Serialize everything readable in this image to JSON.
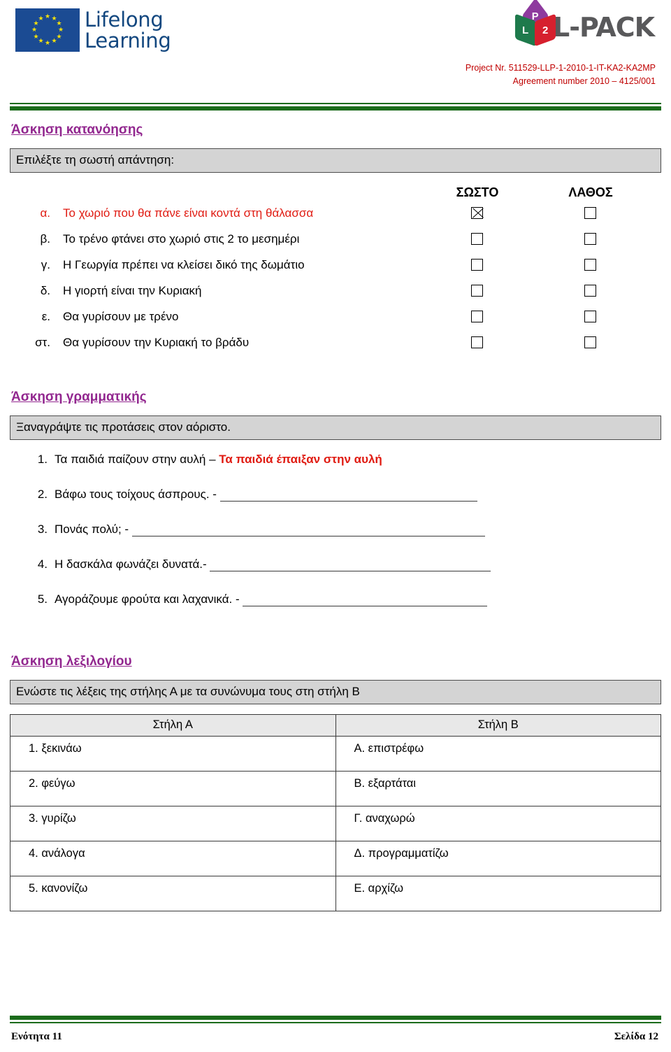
{
  "header": {
    "eu_logo_line1": "Lifelong",
    "eu_logo_line2": "Learning",
    "lpack_cube_top": "P",
    "lpack_cube_left": "L",
    "lpack_cube_right": "2",
    "lpack_word": "L-PACK",
    "project_line1": "Project Nr. 511529-LLP-1-2010-1-IT-KA2-KA2MP",
    "project_line2": "Agreement number 2010 – 4125/001",
    "accent_green": "#1B6B1B",
    "project_text_color": "#C00000"
  },
  "comprehension": {
    "heading": "Άσκηση κατανόησης",
    "instruction": "Επιλέξτε τη σωστή απάντηση:",
    "col_true": "ΣΩΣΤΟ",
    "col_false": "ΛΑΘΟΣ",
    "answer_color": "#E01B12",
    "items": [
      {
        "letter": "α.",
        "text": "Το χωριό που θα πάνε είναι κοντά στη θάλασσα",
        "true_checked": true,
        "false_checked": false,
        "highlighted": true
      },
      {
        "letter": "β.",
        "text": "Το τρένο φτάνει στο χωριό στις 2 το μεσημέρι",
        "true_checked": false,
        "false_checked": false,
        "highlighted": false
      },
      {
        "letter": "γ.",
        "text": "Η Γεωργία πρέπει να κλείσει δικό της δωμάτιο",
        "true_checked": false,
        "false_checked": false,
        "highlighted": false
      },
      {
        "letter": "δ.",
        "text": "Η γιορτή είναι την Κυριακή",
        "true_checked": false,
        "false_checked": false,
        "highlighted": false
      },
      {
        "letter": "ε.",
        "text": "Θα γυρίσουν με τρένο",
        "true_checked": false,
        "false_checked": false,
        "highlighted": false
      },
      {
        "letter": "στ.",
        "text": "Θα γυρίσουν την Κυριακή το βράδυ",
        "true_checked": false,
        "false_checked": false,
        "highlighted": false
      }
    ]
  },
  "grammar": {
    "heading": "Άσκηση γραμματικής",
    "instruction": "Ξαναγράψτε τις προτάσεις στον αόριστο.",
    "items": [
      {
        "num": "1.",
        "prompt": "Τα παιδιά παίζουν στην αυλή – ",
        "answer": "Τα παιδιά έπαιξαν στην αυλή",
        "blank_width": 0
      },
      {
        "num": "2.",
        "prompt": "Βάφω τους τοίχους άσπρους. - ",
        "answer": "",
        "blank_width": 368
      },
      {
        "num": "3.",
        "prompt": "Πονάς  πολύ; - ",
        "answer": "",
        "blank_width": 505
      },
      {
        "num": "4.",
        "prompt": "Η δασκάλα φωνάζει δυνατά.- ",
        "answer": "",
        "blank_width": 402
      },
      {
        "num": "5.",
        "prompt": "Αγοράζουμε φρούτα και λαχανικά. - ",
        "answer": "",
        "blank_width": 350
      }
    ]
  },
  "vocabulary": {
    "heading": "Άσκηση λεξιλογίου",
    "instruction": "Ενώστε τις λέξεις της στήλης Α με τα συνώνυμα τους στη στήλη Β",
    "columns": [
      "Στήλη Α",
      "Στήλη Β"
    ],
    "rows": [
      {
        "a": "1. ξεκινάω",
        "b": "Α. επιστρέφω"
      },
      {
        "a": "2. φεύγω",
        "b": "Β. εξαρτάται"
      },
      {
        "a": "3. γυρίζω",
        "b": "Γ. αναχωρώ"
      },
      {
        "a": "4. ανάλογα",
        "b": "Δ. προγραμματίζω"
      },
      {
        "a": "5. κανονίζω",
        "b": "Ε. αρχίζω"
      }
    ]
  },
  "footer": {
    "left": "Ενότητα 11",
    "right": "Σελίδα 12"
  }
}
